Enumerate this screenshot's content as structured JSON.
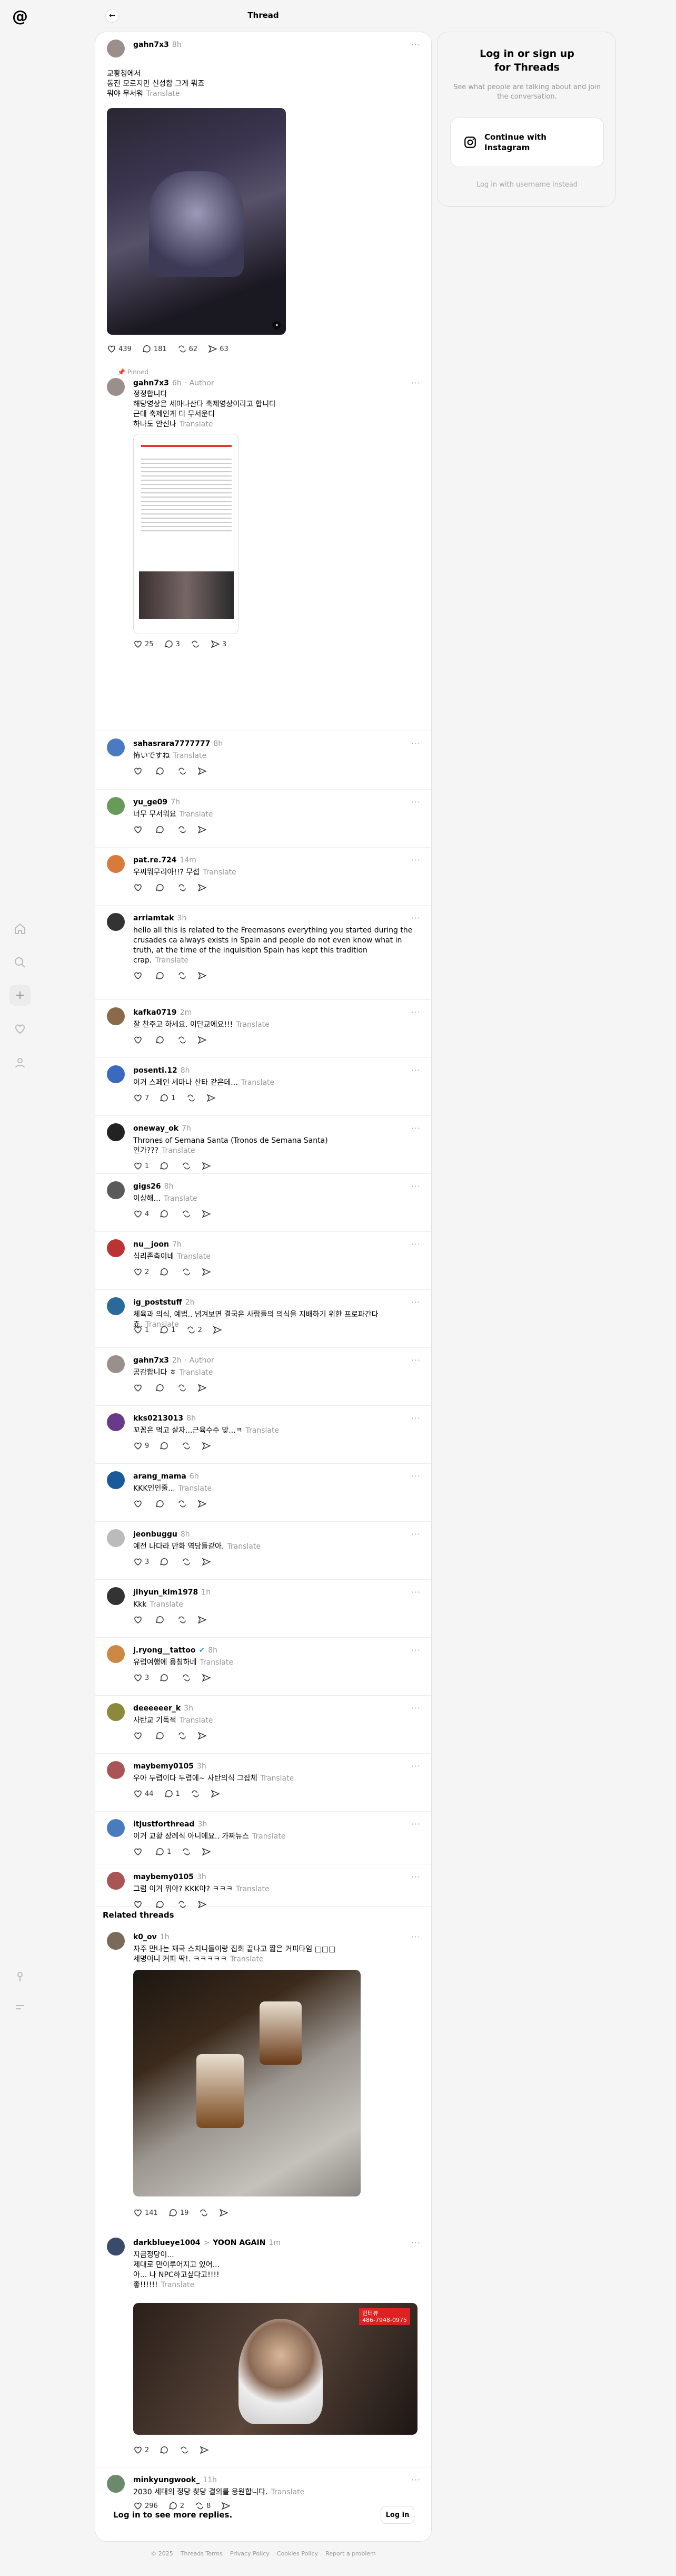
{
  "header": {
    "title": "Thread"
  },
  "login_panel": {
    "title": "Log in or sign up\nfor Threads",
    "subtitle": "See what people are talking about and join the conversation.",
    "continue_label": "Continue with\nInstagram",
    "alt_label": "Log in with username instead"
  },
  "translate": "Translate",
  "pinned": "Pinned",
  "author": "Author",
  "main_post": {
    "user": "gahn7x3",
    "time": "8h",
    "text": "교황청에서\n동진 모르지만 신성합 그게 뭐죠\n뭐야 무서워",
    "likes": "439",
    "replies": "181",
    "reposts": "62",
    "shares": "63"
  },
  "author_reply": {
    "user": "gahn7x3",
    "time": "6h",
    "text": "정정합니다\n해당영상은 세마나산타 축제영상이라고 합니다\n근데 축제인게 더 무서운디\n하나도 안신나",
    "likes": "25",
    "replies": "3",
    "shares": "3"
  },
  "replies": [
    {
      "user": "sahasrara7777777",
      "time": "8h",
      "text": "怖いですね",
      "likes": "",
      "replies": ""
    },
    {
      "user": "yu_ge09",
      "time": "7h",
      "text": "너무 무서워요",
      "likes": "",
      "replies": ""
    },
    {
      "user": "pat.re.724",
      "time": "14m",
      "text": "우씨뭐무리아!!? 무섭",
      "likes": "",
      "replies": ""
    },
    {
      "user": "arriamtak",
      "time": "3h",
      "text": "hello all this is related to the Freemasons everything you started during the crusades ca always exists in Spain and people do not even know what in truth, at the time of the inquisition Spain has kept this tradition crap.",
      "likes": "",
      "replies": ""
    },
    {
      "user": "kafka0719",
      "time": "2m",
      "text": "잘 찬주고 하세요. 이단교에요!!!",
      "likes": "",
      "replies": ""
    },
    {
      "user": "posenti.12",
      "time": "8h",
      "text": "이거 스페인 세마나 산타 같은데...",
      "likes": "7",
      "replies": "1"
    },
    {
      "user": "oneway_ok",
      "time": "7h",
      "text": "Thrones of Semana Santa (Tronos de Semana Santa)\n인가???",
      "likes": "1",
      "replies": ""
    },
    {
      "user": "gigs26",
      "time": "8h",
      "text": "이상해...",
      "likes": "4",
      "replies": ""
    },
    {
      "user": "nu__joon",
      "time": "7h",
      "text": "십리존축이네",
      "likes": "2",
      "replies": ""
    },
    {
      "user": "ig_poststuff",
      "time": "2h",
      "text": "체육과 의식, 예법.. 넘겨보면 결국은 사람들의 의식을 지배하기 위한 프로파간다죠.",
      "likes": "1",
      "replies": "1",
      "shares": "2"
    },
    {
      "user": "gahn7x3",
      "time": "2h",
      "text": "공감합니다 ㅎ",
      "likes": "",
      "replies": "",
      "is_author": true
    },
    {
      "user": "kks0213013",
      "time": "8h",
      "text": "꼬꼼은 먹고 살자...근육수수 맞...ㅋ",
      "likes": "9",
      "replies": ""
    },
    {
      "user": "arang_mama",
      "time": "6h",
      "text": "KKK인인줄...",
      "likes": "",
      "replies": ""
    },
    {
      "user": "jeonbuggu",
      "time": "8h",
      "text": "예전 나다라 만화 역당들같아.",
      "likes": "3",
      "replies": ""
    },
    {
      "user": "jihyun_kim1978",
      "time": "1h",
      "text": "Kkk",
      "likes": "",
      "replies": ""
    },
    {
      "user": "j.ryong__tattoo",
      "time": "8h",
      "text": "유럽여행에 용침하네",
      "likes": "3",
      "replies": "",
      "verified": true
    },
    {
      "user": "deeeeeer_k",
      "time": "3h",
      "text": "사탄교 기독적",
      "likes": "",
      "replies": ""
    },
    {
      "user": "maybemy0105",
      "time": "3h",
      "text": "우아 두렵이다 두렵에~ 사탄의식 그잡체",
      "likes": "44",
      "replies": "1"
    },
    {
      "user": "itjustforthread",
      "time": "3h",
      "text": "이거 교황 장례식 아니에요.. 가짜뉴스",
      "likes": "",
      "replies": "1"
    },
    {
      "user": "maybemy0105",
      "time": "3h",
      "text": "그럼 이거 뭐야? KKK야? ㅋㅋㅋ",
      "likes": "",
      "replies": ""
    }
  ],
  "related_title": "Related threads",
  "related": [
    {
      "user": "k0_ov",
      "time": "1h",
      "text": "자주 만나는 재국 스치니들이랑 집회 끝나고 짧은 커피타임 □□□\n세명이니 커피 딱!. ㅋㅋㅋㅋㅋ",
      "likes": "141",
      "replies": "19"
    },
    {
      "user": "darkblueye1004",
      "user2": "YOON AGAIN",
      "time": "1m",
      "text": "지금정당이...\n제대로 만이루어지고 있어...\n아... 나 NPC하고싶다고!!!!\n좋!!!!!!",
      "likes": "2",
      "replies": "",
      "video_caption": "인터뷰\n486-7948-0975"
    },
    {
      "user": "minkyungwook_",
      "time": "11h",
      "text": "2030 세대의 정당 찾당 결의를 응원합니다.",
      "likes": "296",
      "replies": "2",
      "shares": "8"
    }
  ],
  "login_bar": {
    "text": "Log in to see more replies.",
    "button": "Log in"
  },
  "footer": [
    "© 2025",
    "Threads Terms",
    "Privacy Policy",
    "Cookies Policy",
    "Report a problem"
  ]
}
